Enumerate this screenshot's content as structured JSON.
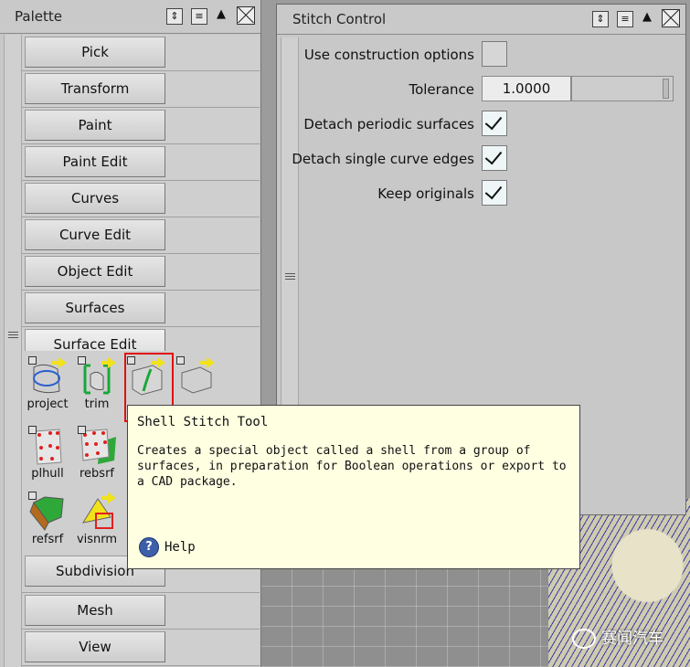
{
  "palette": {
    "title": "Palette",
    "sections": [
      {
        "label": "Pick"
      },
      {
        "label": "Transform"
      },
      {
        "label": "Paint"
      },
      {
        "label": "Paint Edit"
      },
      {
        "label": "Curves"
      },
      {
        "label": "Curve Edit"
      },
      {
        "label": "Object Edit"
      },
      {
        "label": "Surfaces"
      },
      {
        "label": "Surface Edit"
      }
    ],
    "tools": [
      {
        "label": "project",
        "icon": "project-icon"
      },
      {
        "label": "trim",
        "icon": "trim-icon"
      },
      {
        "label": "",
        "icon": "shell-stitch-icon"
      },
      {
        "label": "",
        "icon": "shell-icon"
      },
      {
        "label": "plhull",
        "icon": "plhull-icon"
      },
      {
        "label": "rebsrf",
        "icon": "rebsrf-icon"
      },
      {
        "label": "refsrf",
        "icon": "refsrf-icon"
      },
      {
        "label": "visnrm",
        "icon": "visnrm-icon"
      }
    ],
    "lower_sections": [
      {
        "label": "Subdivision"
      },
      {
        "label": "Mesh"
      },
      {
        "label": "View"
      }
    ]
  },
  "stitch": {
    "title": "Stitch Control",
    "use_construction_label": "Use construction options",
    "use_construction_checked": false,
    "tolerance_label": "Tolerance",
    "tolerance_value": "1.0000",
    "detach_periodic_label": "Detach periodic surfaces",
    "detach_periodic_checked": true,
    "detach_single_label": "Detach single curve edges",
    "detach_single_checked": true,
    "keep_originals_label": "Keep originals",
    "keep_originals_checked": true
  },
  "tooltip": {
    "title": "Shell Stitch Tool",
    "body": "Creates a special object called a shell from a group of surfaces, in preparation for Boolean operations or export to a CAD package.",
    "help": "Help"
  },
  "watermark": "赛闻汽车",
  "colors": {
    "selection_frame": "#e01010",
    "tooltip_bg": "#ffffe2",
    "checkbox_bg": "#eef6f7"
  }
}
